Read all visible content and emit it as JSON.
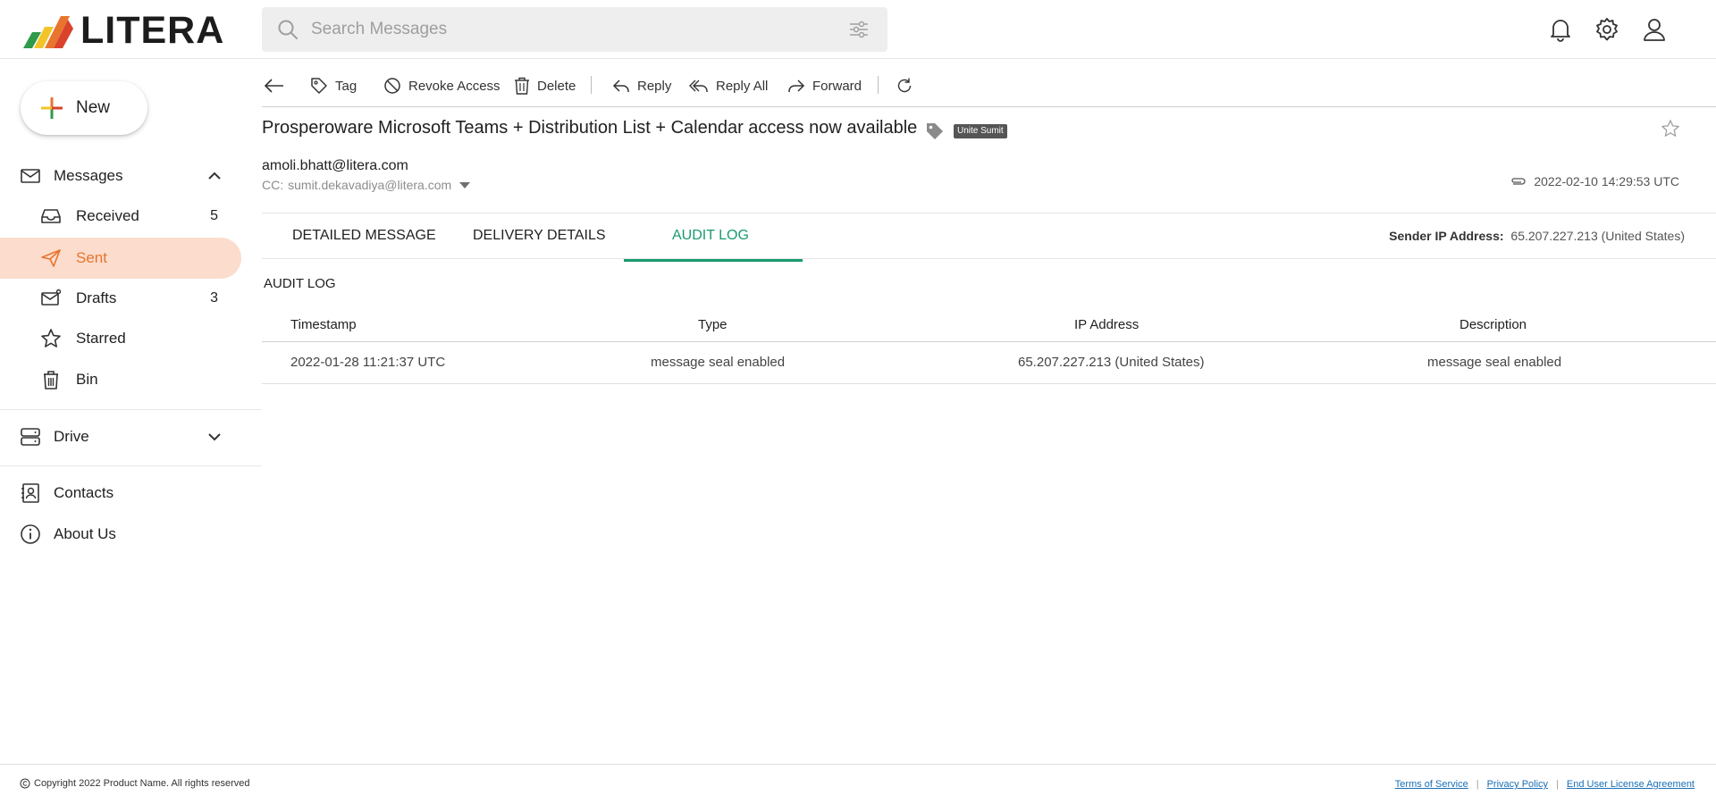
{
  "app": {
    "logo_text": "LITERA",
    "search_placeholder": "Search Messages"
  },
  "sidebar": {
    "new_label": "New",
    "messages_label": "Messages",
    "items": [
      {
        "label": "Received",
        "count": "5"
      },
      {
        "label": "Sent",
        "count": ""
      },
      {
        "label": "Drafts",
        "count": "3"
      },
      {
        "label": "Starred",
        "count": ""
      },
      {
        "label": "Bin",
        "count": ""
      }
    ],
    "drive_label": "Drive",
    "contacts_label": "Contacts",
    "about_label": "About Us"
  },
  "toolbar": {
    "tag": "Tag",
    "revoke": "Revoke Access",
    "delete": "Delete",
    "reply": "Reply",
    "reply_all": "Reply All",
    "forward": "Forward"
  },
  "message": {
    "subject": "Prosperoware Microsoft Teams + Distribution List + Calendar access now available",
    "tag_badge": "Unite Sumit",
    "from": "amoli.bhatt@litera.com",
    "cc_label": "CC:",
    "cc_value": "sumit.dekavadiya@litera.com",
    "date": "2022-02-10 14:29:53 UTC"
  },
  "tabs": {
    "items": [
      "DETAILED MESSAGE",
      "DELIVERY DETAILS",
      "AUDIT LOG"
    ],
    "active": "AUDIT LOG",
    "sender_ip_label": "Sender IP Address:",
    "sender_ip_value": "65.207.227.213 (United States)"
  },
  "audit": {
    "title": "AUDIT LOG",
    "columns": [
      "Timestamp",
      "Type",
      "IP Address",
      "Description"
    ],
    "rows": [
      [
        "2022-01-28 11:21:37 UTC",
        "message seal enabled",
        "65.207.227.213 (United States)",
        "message seal enabled"
      ]
    ]
  },
  "footer": {
    "copyright": "Copyright 2022 Product Name. All rights reserved",
    "links": [
      "Terms of Service",
      "Privacy Policy",
      "End User License Agreement"
    ]
  },
  "colors": {
    "accent_orange": "#e8742d",
    "active_bg": "#fbdccd",
    "tab_green": "#1a9a6e",
    "link_blue": "#1a6fb5"
  }
}
